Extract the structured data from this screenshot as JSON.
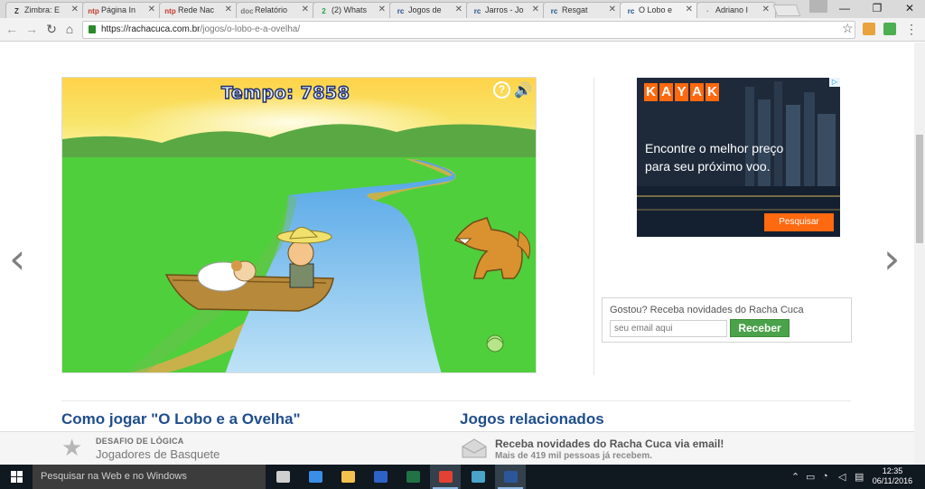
{
  "browser": {
    "tabs": [
      {
        "title": "Zimbra: E",
        "icon": "Z",
        "color": "#333333"
      },
      {
        "title": "Página In",
        "icon": "ntp",
        "color": "#c0392b"
      },
      {
        "title": "Rede Nac",
        "icon": "ntp",
        "color": "#c0392b"
      },
      {
        "title": "Relatório",
        "icon": "doc",
        "color": "#777777"
      },
      {
        "title": "(2) Whats",
        "icon": "2",
        "color": "#25a244"
      },
      {
        "title": "Jogos de",
        "icon": "rc",
        "color": "#1f4e8c"
      },
      {
        "title": "Jarros - Jo",
        "icon": "rc",
        "color": "#1f4e8c"
      },
      {
        "title": "Resgat",
        "icon": "rc",
        "color": "#1f4e8c"
      },
      {
        "title": "O Lobo e",
        "icon": "rc",
        "color": "#1f4e8c"
      },
      {
        "title": "Adriano I",
        "icon": "·",
        "color": "#777777"
      }
    ],
    "active_tab": 8,
    "url_host": "https://racha cuca.com.br",
    "url_path": "/jogos/o-lobo-e-a-ovelha/",
    "url_display_host": "https://rachacuca.com.br",
    "window_controls": [
      "—",
      "❐",
      "✕"
    ]
  },
  "game": {
    "timer": "Tempo: 7858",
    "help_glyph": "?",
    "sound_glyph": "🔊"
  },
  "nav": {
    "prev_glyph": "‹",
    "next_glyph": "›"
  },
  "ad": {
    "brand_letters": [
      "K",
      "A",
      "Y",
      "A",
      "K"
    ],
    "headline": "Encontre o melhor preço para seu próximo voo.",
    "cta": "Pesquisar",
    "adchoices": "▷"
  },
  "newsletter": {
    "prompt": "Gostou? Receba novidades do Racha Cuca",
    "placeholder": "seu email aqui",
    "button": "Receber"
  },
  "sections": {
    "how_to_play": "Como jogar \"O Lobo e a Ovelha\"",
    "related_games": "Jogos relacionados"
  },
  "sticky": {
    "kicker": "DESAFIO DE LÓGICA",
    "title": "Jogadores de Basquete",
    "news_title": "Receba novidades do Racha Cuca via email!",
    "news_sub": "Mais de 419 mil pessoas já recebem."
  },
  "taskbar": {
    "search_placeholder": "Pesquisar na Web e no Windows",
    "apps": [
      {
        "name": "task-view",
        "color": "#cfcfcf",
        "on": false
      },
      {
        "name": "edge",
        "color": "#3a8ee6",
        "on": false
      },
      {
        "name": "file-explorer",
        "color": "#f2c14e",
        "on": false
      },
      {
        "name": "app-blue",
        "color": "#2d63c8",
        "on": false
      },
      {
        "name": "excel",
        "color": "#217346",
        "on": false
      },
      {
        "name": "chrome",
        "color": "#e34133",
        "on": true
      },
      {
        "name": "app-teal",
        "color": "#4aa3c8",
        "on": false
      },
      {
        "name": "word",
        "color": "#2b579a",
        "on": true
      }
    ],
    "time": "12:35",
    "date": "06/11/2016"
  },
  "colors": {
    "link_blue": "#1f4e8c",
    "kayak_orange": "#ff690f",
    "button_green": "#4aa24a"
  }
}
